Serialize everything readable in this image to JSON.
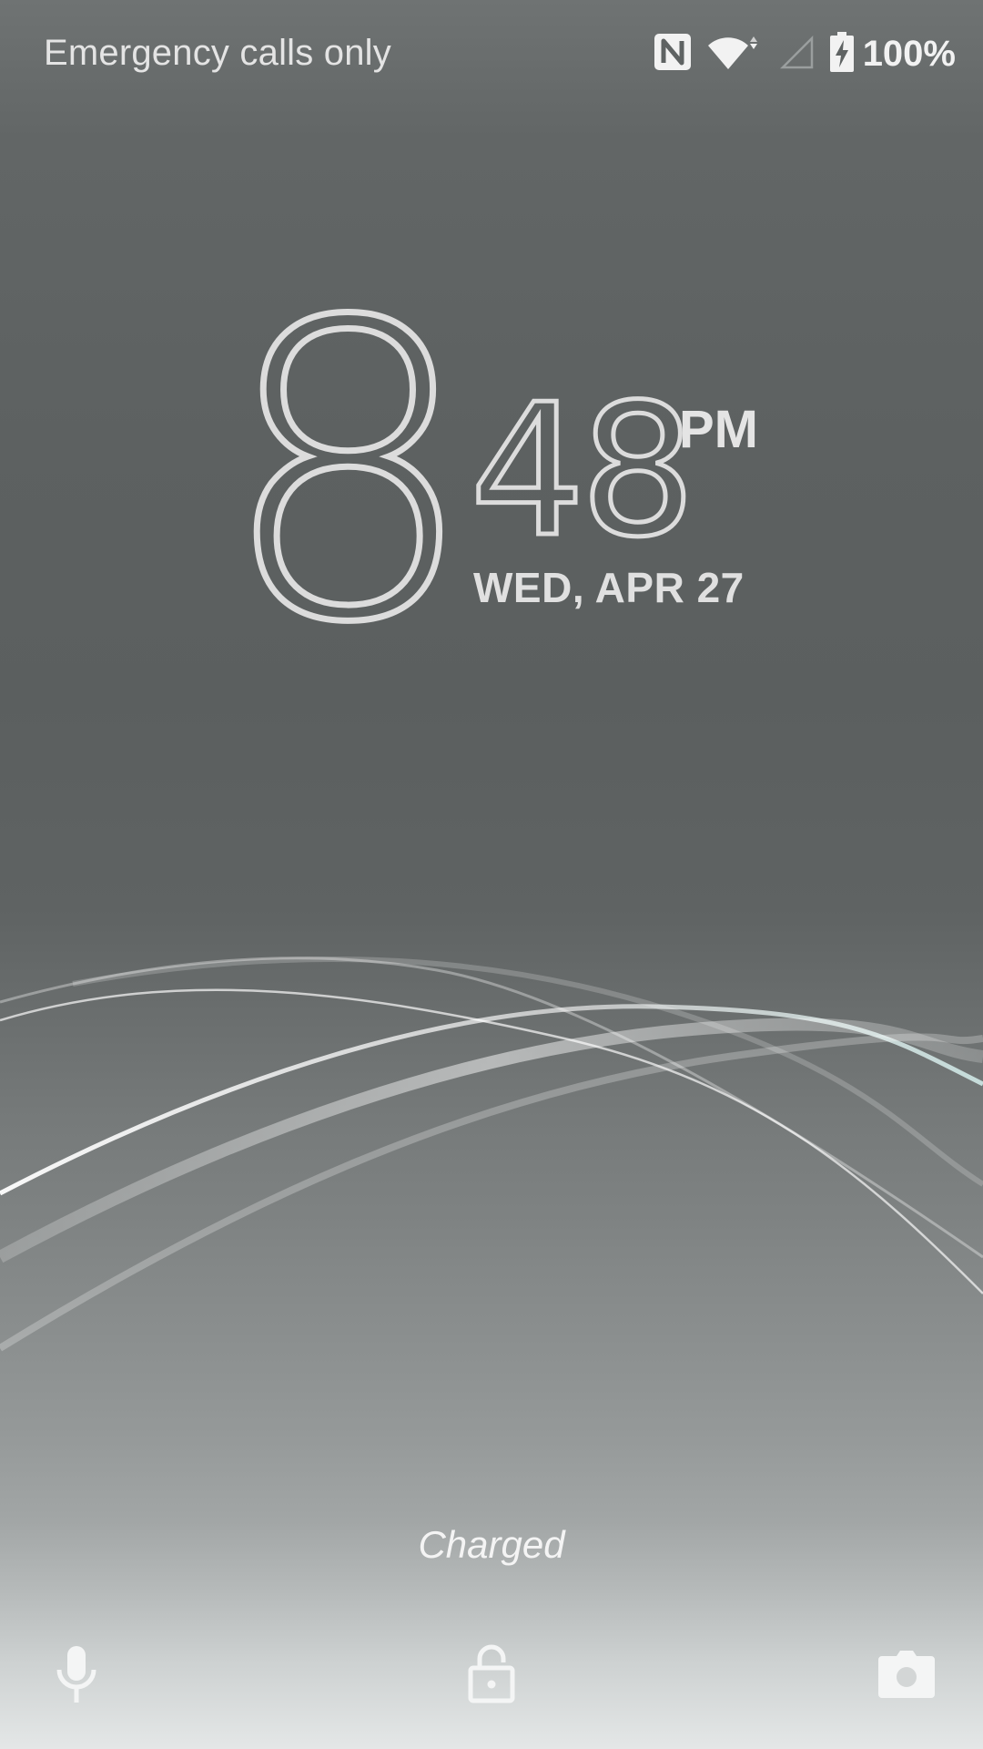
{
  "status_bar": {
    "carrier_text": "Emergency calls only",
    "icons": [
      "nfc-icon",
      "wifi-icon",
      "cell-signal-icon",
      "battery-charging-icon"
    ],
    "battery_percent": "100%"
  },
  "clock": {
    "hour": "8",
    "minutes": "48",
    "ampm": "PM",
    "date": "WED, APR 27"
  },
  "charge_status": "Charged",
  "shortcuts": {
    "left": "microphone-icon",
    "center": "unlock-icon",
    "right": "camera-icon"
  },
  "colors": {
    "text": "#e6e6e6",
    "background_top": "#626666",
    "background_bottom": "#e4e7e7"
  }
}
